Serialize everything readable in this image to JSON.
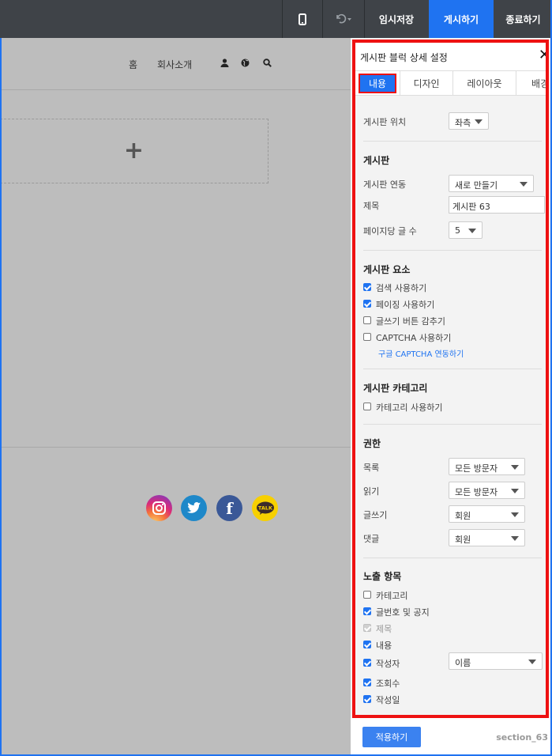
{
  "topbar": {
    "mobile_icon": "mobile-phone-icon",
    "undo_icon": "undo-icon",
    "temp_save_label": "임시저장",
    "publish_label": "게시하기",
    "exit_label": "종료하기"
  },
  "nav": {
    "home": "홈",
    "about": "회사소개",
    "icons": [
      "user-icon",
      "globe-icon",
      "search-icon"
    ]
  },
  "page": {
    "add_icon": "+"
  },
  "social": [
    {
      "name": "instagram-icon",
      "glyph": "◎"
    },
    {
      "name": "twitter-icon",
      "glyph": "🐦"
    },
    {
      "name": "facebook-icon",
      "glyph": "f"
    },
    {
      "name": "kakaotalk-icon",
      "glyph": "TALK"
    }
  ],
  "panel": {
    "title": "게시판 블럭 상세 설정",
    "close": "✕",
    "tabs": [
      "내용",
      "디자인",
      "레이아웃",
      "배경"
    ],
    "position": {
      "label": "게시판 위치",
      "value": "좌측"
    },
    "board": {
      "title": "게시판",
      "link_label": "게시판 연동",
      "link_value": "새로 만들기",
      "subject_label": "제목",
      "subject_value": "게시판 63",
      "per_page_label": "페이지당 글 수",
      "per_page_value": "5"
    },
    "elements": {
      "title": "게시판 요소",
      "items": [
        {
          "label": "검색 사용하기",
          "checked": true
        },
        {
          "label": "페이징 사용하기",
          "checked": true
        },
        {
          "label": "글쓰기 버튼 감추기",
          "checked": false
        },
        {
          "label": "CAPTCHA 사용하기",
          "checked": false
        }
      ],
      "captcha_link": "구글 CAPTCHA 연동하기"
    },
    "category": {
      "title": "게시판 카테고리",
      "use_label": "카테고리 사용하기",
      "checked": false
    },
    "permission": {
      "title": "권한",
      "rows": [
        {
          "label": "목록",
          "value": "모든 방문자"
        },
        {
          "label": "읽기",
          "value": "모든 방문자"
        },
        {
          "label": "글쓰기",
          "value": "회원"
        },
        {
          "label": "댓글",
          "value": "회원"
        }
      ]
    },
    "display": {
      "title": "노출 항목",
      "items": [
        {
          "label": "카테고리",
          "state": "off"
        },
        {
          "label": "글번호 및 공지",
          "state": "on"
        },
        {
          "label": "제목",
          "state": "disabled"
        },
        {
          "label": "내용",
          "state": "on"
        },
        {
          "label": "작성자",
          "state": "on"
        },
        {
          "label": "조회수",
          "state": "on"
        },
        {
          "label": "작성일",
          "state": "on"
        }
      ],
      "author_select": "이름"
    }
  },
  "bottom": {
    "apply_label": "적용하기",
    "section_id": "section_63"
  },
  "colors": {
    "accent": "#1f73f1",
    "highlight_border": "#ee1111",
    "topbar": "#3f4348"
  }
}
